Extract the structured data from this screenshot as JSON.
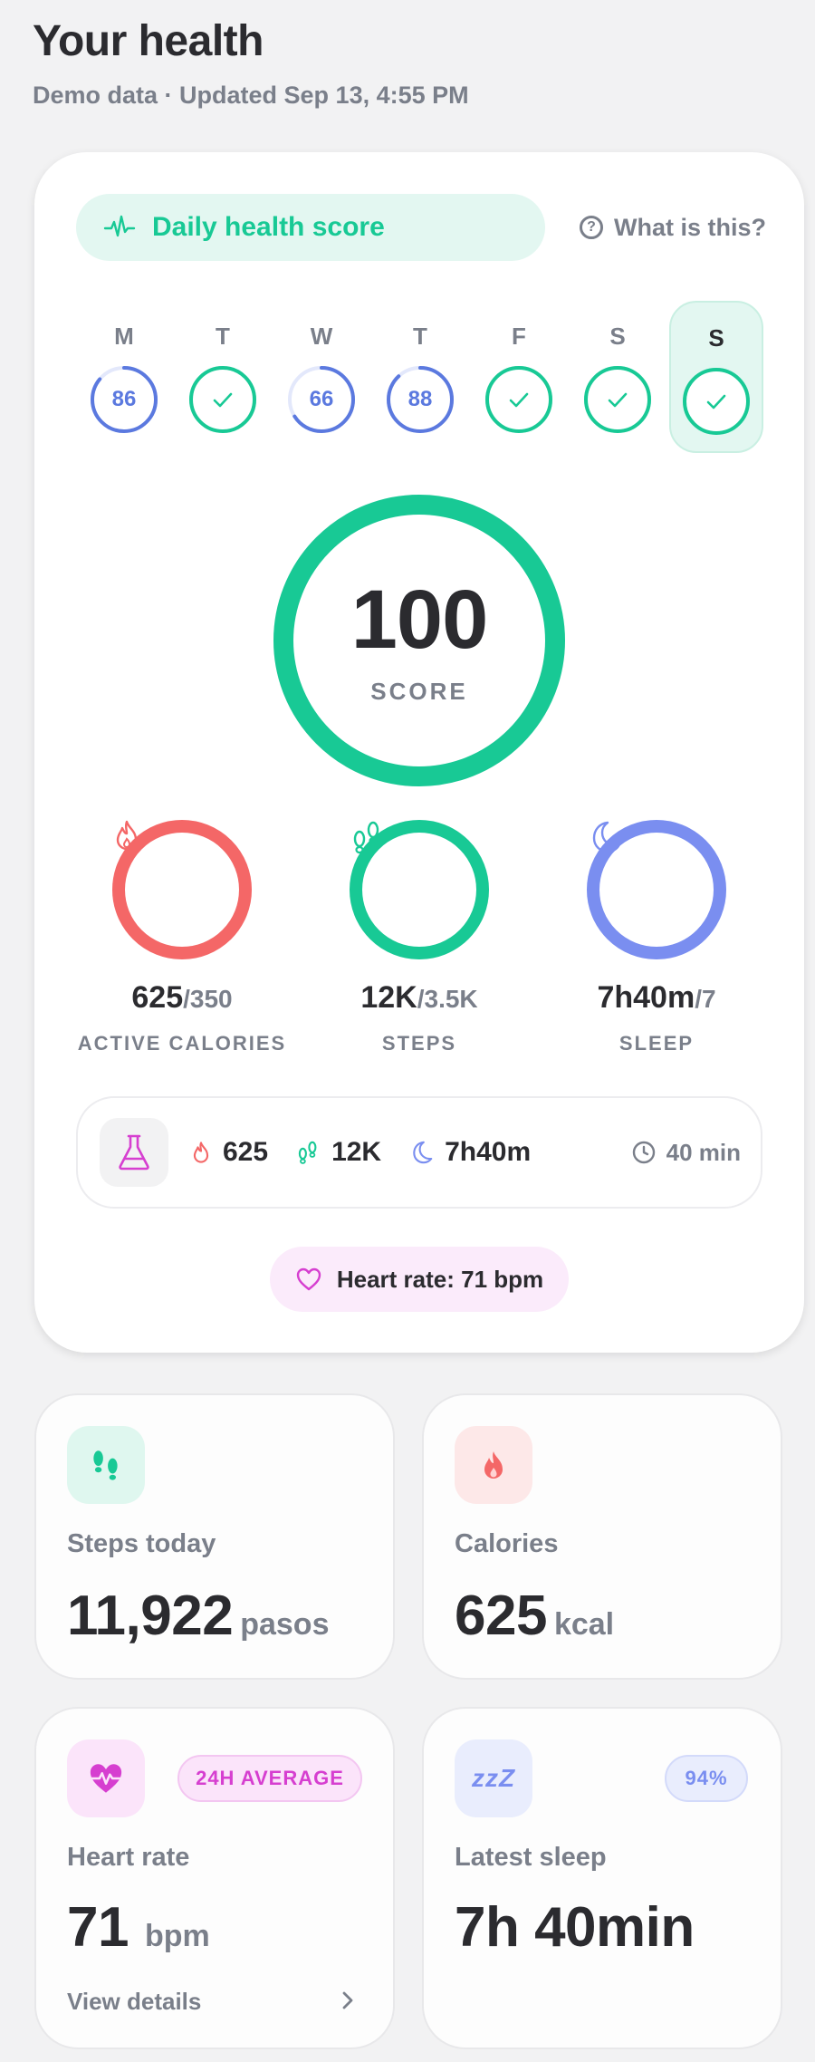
{
  "header": {
    "title": "Your health",
    "subtitle": "Demo data · Updated Sep 13, 4:55 PM"
  },
  "score_card": {
    "pill_label": "Daily health score",
    "help_label": "What is this?",
    "help_icon_glyph": "?",
    "week": [
      {
        "letter": "M",
        "state": "score",
        "value": "86",
        "progress": 0.86
      },
      {
        "letter": "T",
        "state": "done",
        "value": "",
        "progress": 1
      },
      {
        "letter": "W",
        "state": "score",
        "value": "66",
        "progress": 0.66
      },
      {
        "letter": "T",
        "state": "score",
        "value": "88",
        "progress": 0.88
      },
      {
        "letter": "F",
        "state": "done",
        "value": "",
        "progress": 1
      },
      {
        "letter": "S",
        "state": "done",
        "value": "",
        "progress": 1
      },
      {
        "letter": "S",
        "state": "done",
        "value": "",
        "progress": 1,
        "active": true
      }
    ],
    "score_value": "100",
    "score_progress": 1.0,
    "score_label": "SCORE",
    "metrics": [
      {
        "key": "calories",
        "value": "625",
        "goal": "/350",
        "label": "ACTIVE CALORIES",
        "color": "#f46767",
        "progress": 1.0,
        "icon": "flame-icon"
      },
      {
        "key": "steps",
        "value": "12K",
        "goal": "/3.5K",
        "label": "STEPS",
        "color": "#18c995",
        "progress": 1.0,
        "icon": "footprints-icon"
      },
      {
        "key": "sleep",
        "value": "7h40m",
        "goal": "/7",
        "label": "SLEEP",
        "color": "#7a8ef0",
        "progress": 1.0,
        "icon": "moon-icon"
      }
    ],
    "summary": {
      "calories": "625",
      "steps": "12K",
      "sleep": "7h40m",
      "time": "40 min"
    },
    "heart_pill": "Heart rate: 71 bpm"
  },
  "tiles": {
    "steps": {
      "title": "Steps today",
      "value": "11,922",
      "unit": "pasos"
    },
    "calories": {
      "title": "Calories",
      "value": "625",
      "unit": "kcal"
    },
    "heart": {
      "title": "Heart rate",
      "value": "71",
      "unit": "bpm",
      "badge": "24H AVERAGE",
      "link": "View details"
    },
    "sleep": {
      "title": "Latest sleep",
      "value": "7h 40min",
      "badge": "94%",
      "icon_glyph": "zzZ"
    }
  },
  "colors": {
    "green": "#18c995",
    "blue": "#5b79df",
    "red": "#f46767",
    "purple": "#7a8ef0",
    "magenta": "#d63fd0"
  }
}
